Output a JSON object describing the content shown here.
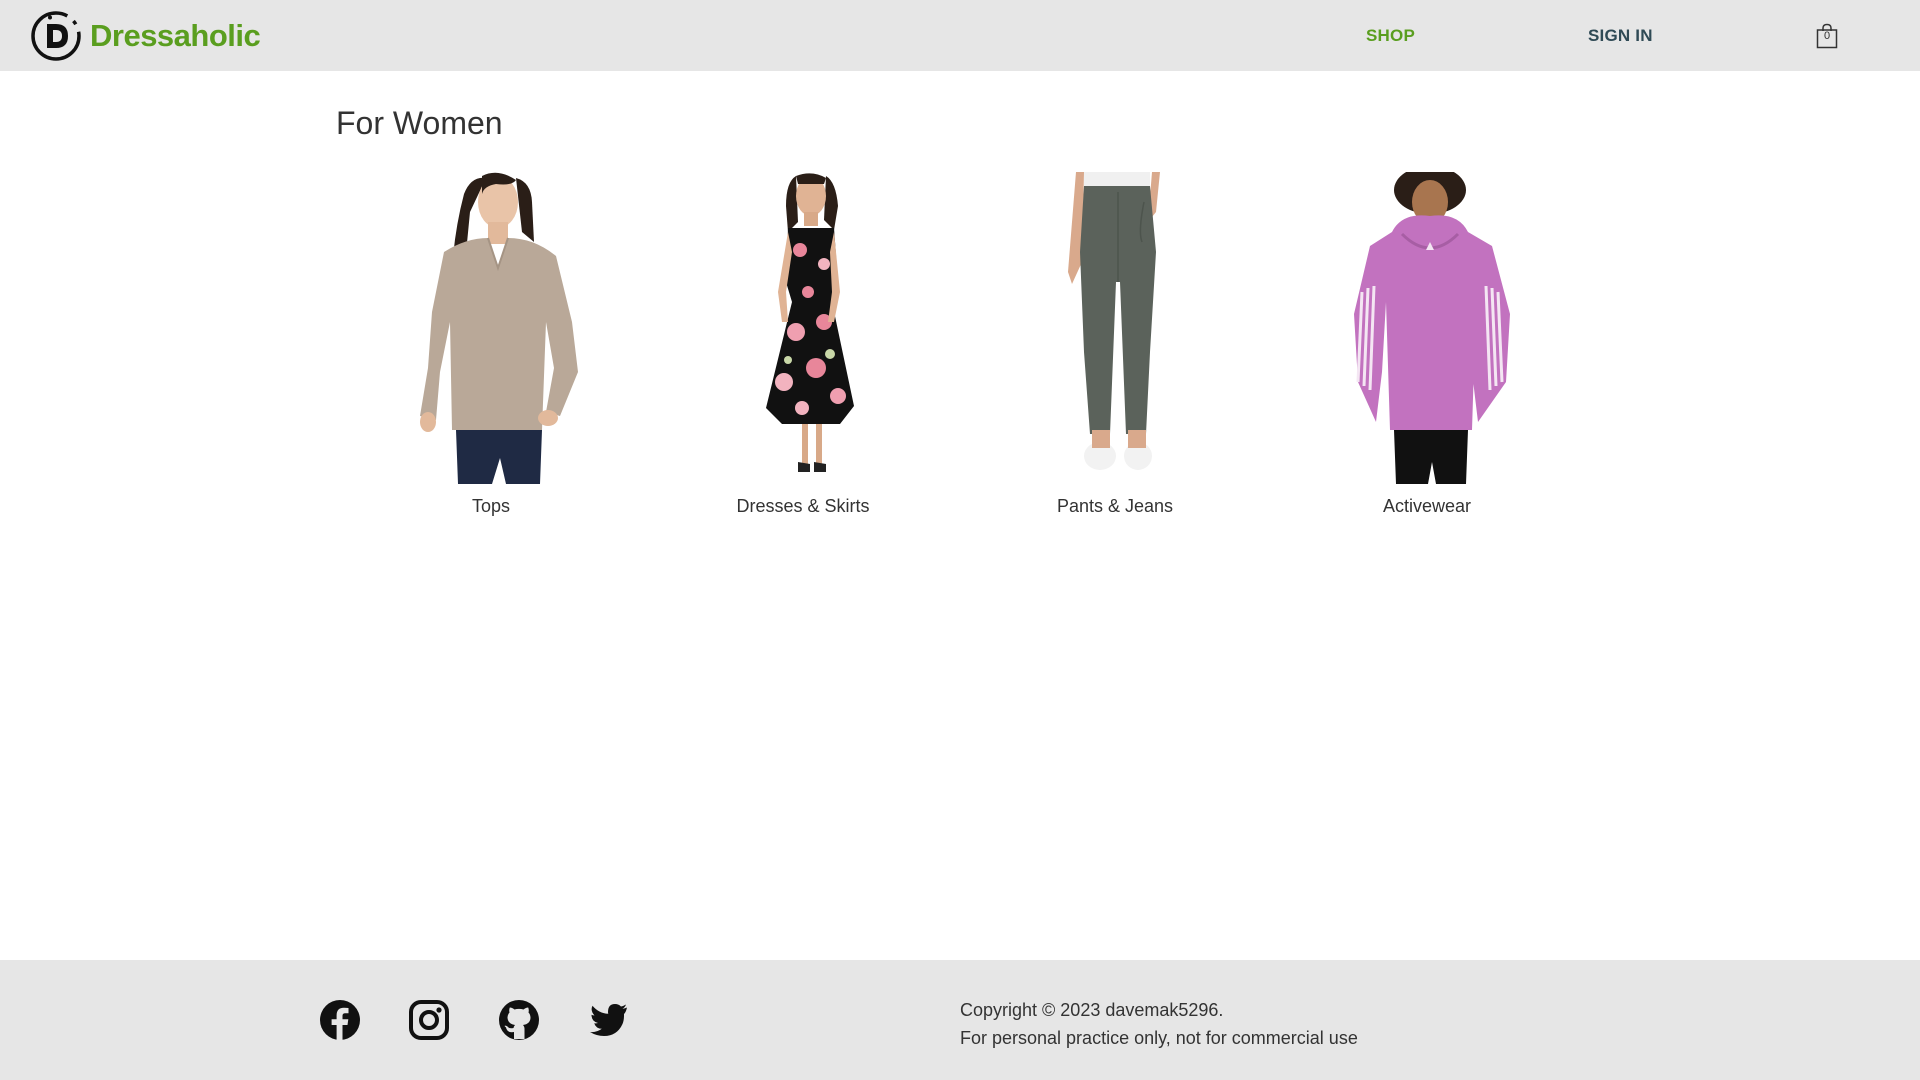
{
  "header": {
    "brand": {
      "name": "Dressaholic",
      "logo_icon": "dressaholic-logo-icon",
      "color": "#5a9e1f"
    },
    "nav": {
      "shop_label": "SHOP",
      "signin_label": "SIGN IN",
      "shop_color": "#5a9e1f",
      "signin_color": "#2f4a55"
    },
    "cart": {
      "icon": "shopping-bag-icon",
      "count": "0"
    },
    "background": "#e6e6e6"
  },
  "main": {
    "title": "For Women",
    "categories": [
      {
        "label": "Tops",
        "image": "beige-v-neck-sweater"
      },
      {
        "label": "Dresses & Skirts",
        "image": "floral-maxi-dress"
      },
      {
        "label": "Pants & Jeans",
        "image": "olive-jogger-pants"
      },
      {
        "label": "Activewear",
        "image": "pink-striped-hoodie"
      }
    ]
  },
  "footer": {
    "social": [
      {
        "name": "facebook-icon"
      },
      {
        "name": "instagram-icon"
      },
      {
        "name": "github-icon"
      },
      {
        "name": "twitter-icon"
      }
    ],
    "copyright": "Copyright © 2023 davemak5296.",
    "disclaimer": "For personal practice only, not for commercial use",
    "background": "#e6e6e6"
  }
}
